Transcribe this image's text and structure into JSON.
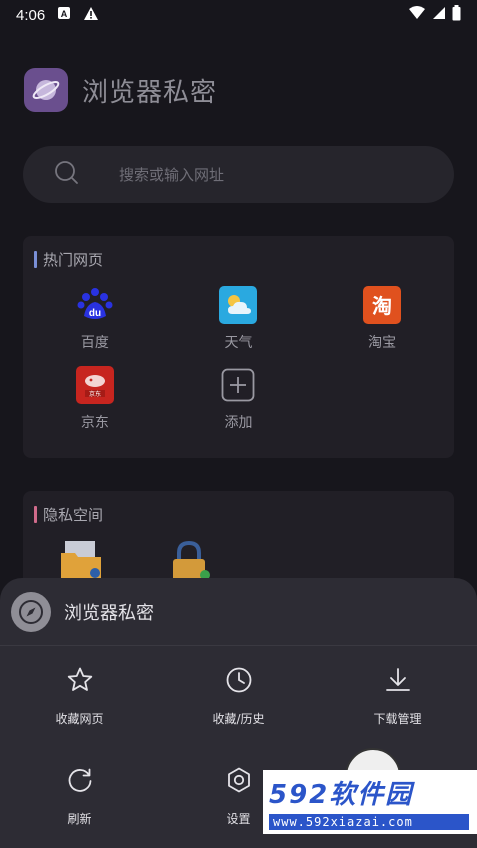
{
  "status_bar": {
    "time": "4:06"
  },
  "app": {
    "title": "浏览器私密",
    "logo_icon": "planet-icon",
    "logo_color": "#6a4f8e"
  },
  "search": {
    "placeholder": "搜索或输入网址"
  },
  "hot_section": {
    "title": "热门网页",
    "accent": "#7a8fd6",
    "items": [
      {
        "label": "百度",
        "icon": "baidu-icon",
        "color": "#2932e1"
      },
      {
        "label": "天气",
        "icon": "weather-icon",
        "color": "#2aa9e0"
      },
      {
        "label": "淘宝",
        "icon": "taobao-icon",
        "color": "#e0511e"
      },
      {
        "label": "京东",
        "icon": "jd-icon",
        "color": "#c7251f"
      },
      {
        "label": "添加",
        "icon": "add-icon",
        "color": "#9a99a2"
      }
    ]
  },
  "private_section": {
    "title": "隐私空间",
    "accent": "#d06b8b",
    "items": [
      {
        "icon": "private-folder-icon"
      },
      {
        "icon": "lock-icon"
      }
    ]
  },
  "sheet": {
    "title": "浏览器私密",
    "actions": [
      {
        "label": "收藏网页",
        "icon": "star-icon"
      },
      {
        "label": "收藏/历史",
        "icon": "clock-icon"
      },
      {
        "label": "下载管理",
        "icon": "download-icon"
      },
      {
        "label": "刷新",
        "icon": "refresh-icon"
      },
      {
        "label": "设置",
        "icon": "settings-icon"
      }
    ]
  },
  "watermark": {
    "brand": "592软件园",
    "url": "www.592xiazai.com"
  }
}
